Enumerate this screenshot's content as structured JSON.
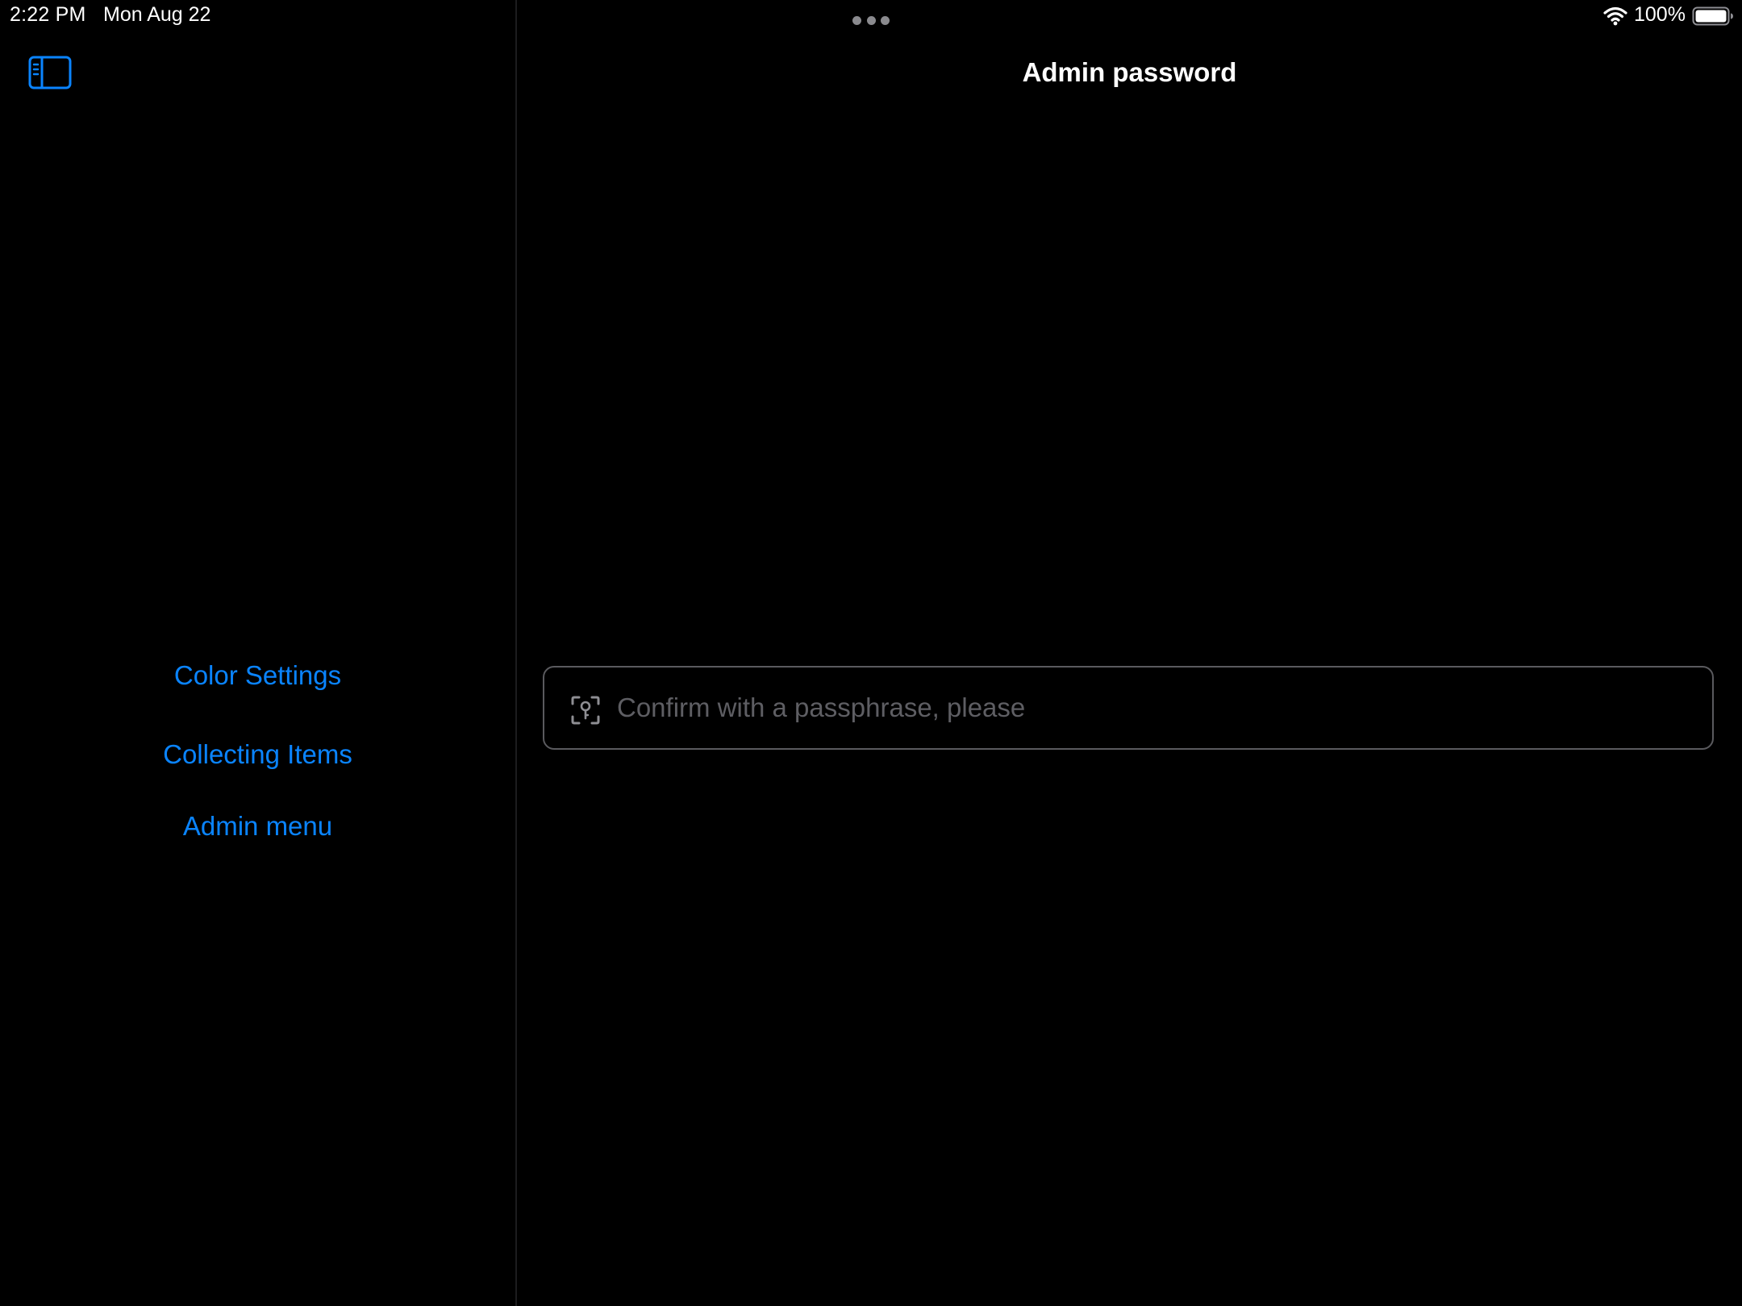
{
  "status_bar": {
    "time": "2:22 PM",
    "date": "Mon Aug 22",
    "battery_percent": "100%",
    "wifi_icon": "wifi-icon",
    "battery_icon": "battery-full-icon",
    "multitask_icon": "more-dots-icon"
  },
  "sidebar": {
    "toggle_icon": "sidebar-toggle-icon",
    "items": [
      {
        "label": "Color Settings"
      },
      {
        "label": "Collecting Items"
      },
      {
        "label": "Admin menu"
      }
    ]
  },
  "detail": {
    "title": "Admin password",
    "passphrase_field": {
      "value": "",
      "placeholder": "Confirm with a passphrase, please",
      "icon": "key-viewfinder-icon"
    }
  },
  "colors": {
    "background": "#000000",
    "accent": "#0a84ff",
    "text_primary": "#ffffff",
    "placeholder": "#5e5e63",
    "field_border": "#5a5a5e"
  }
}
